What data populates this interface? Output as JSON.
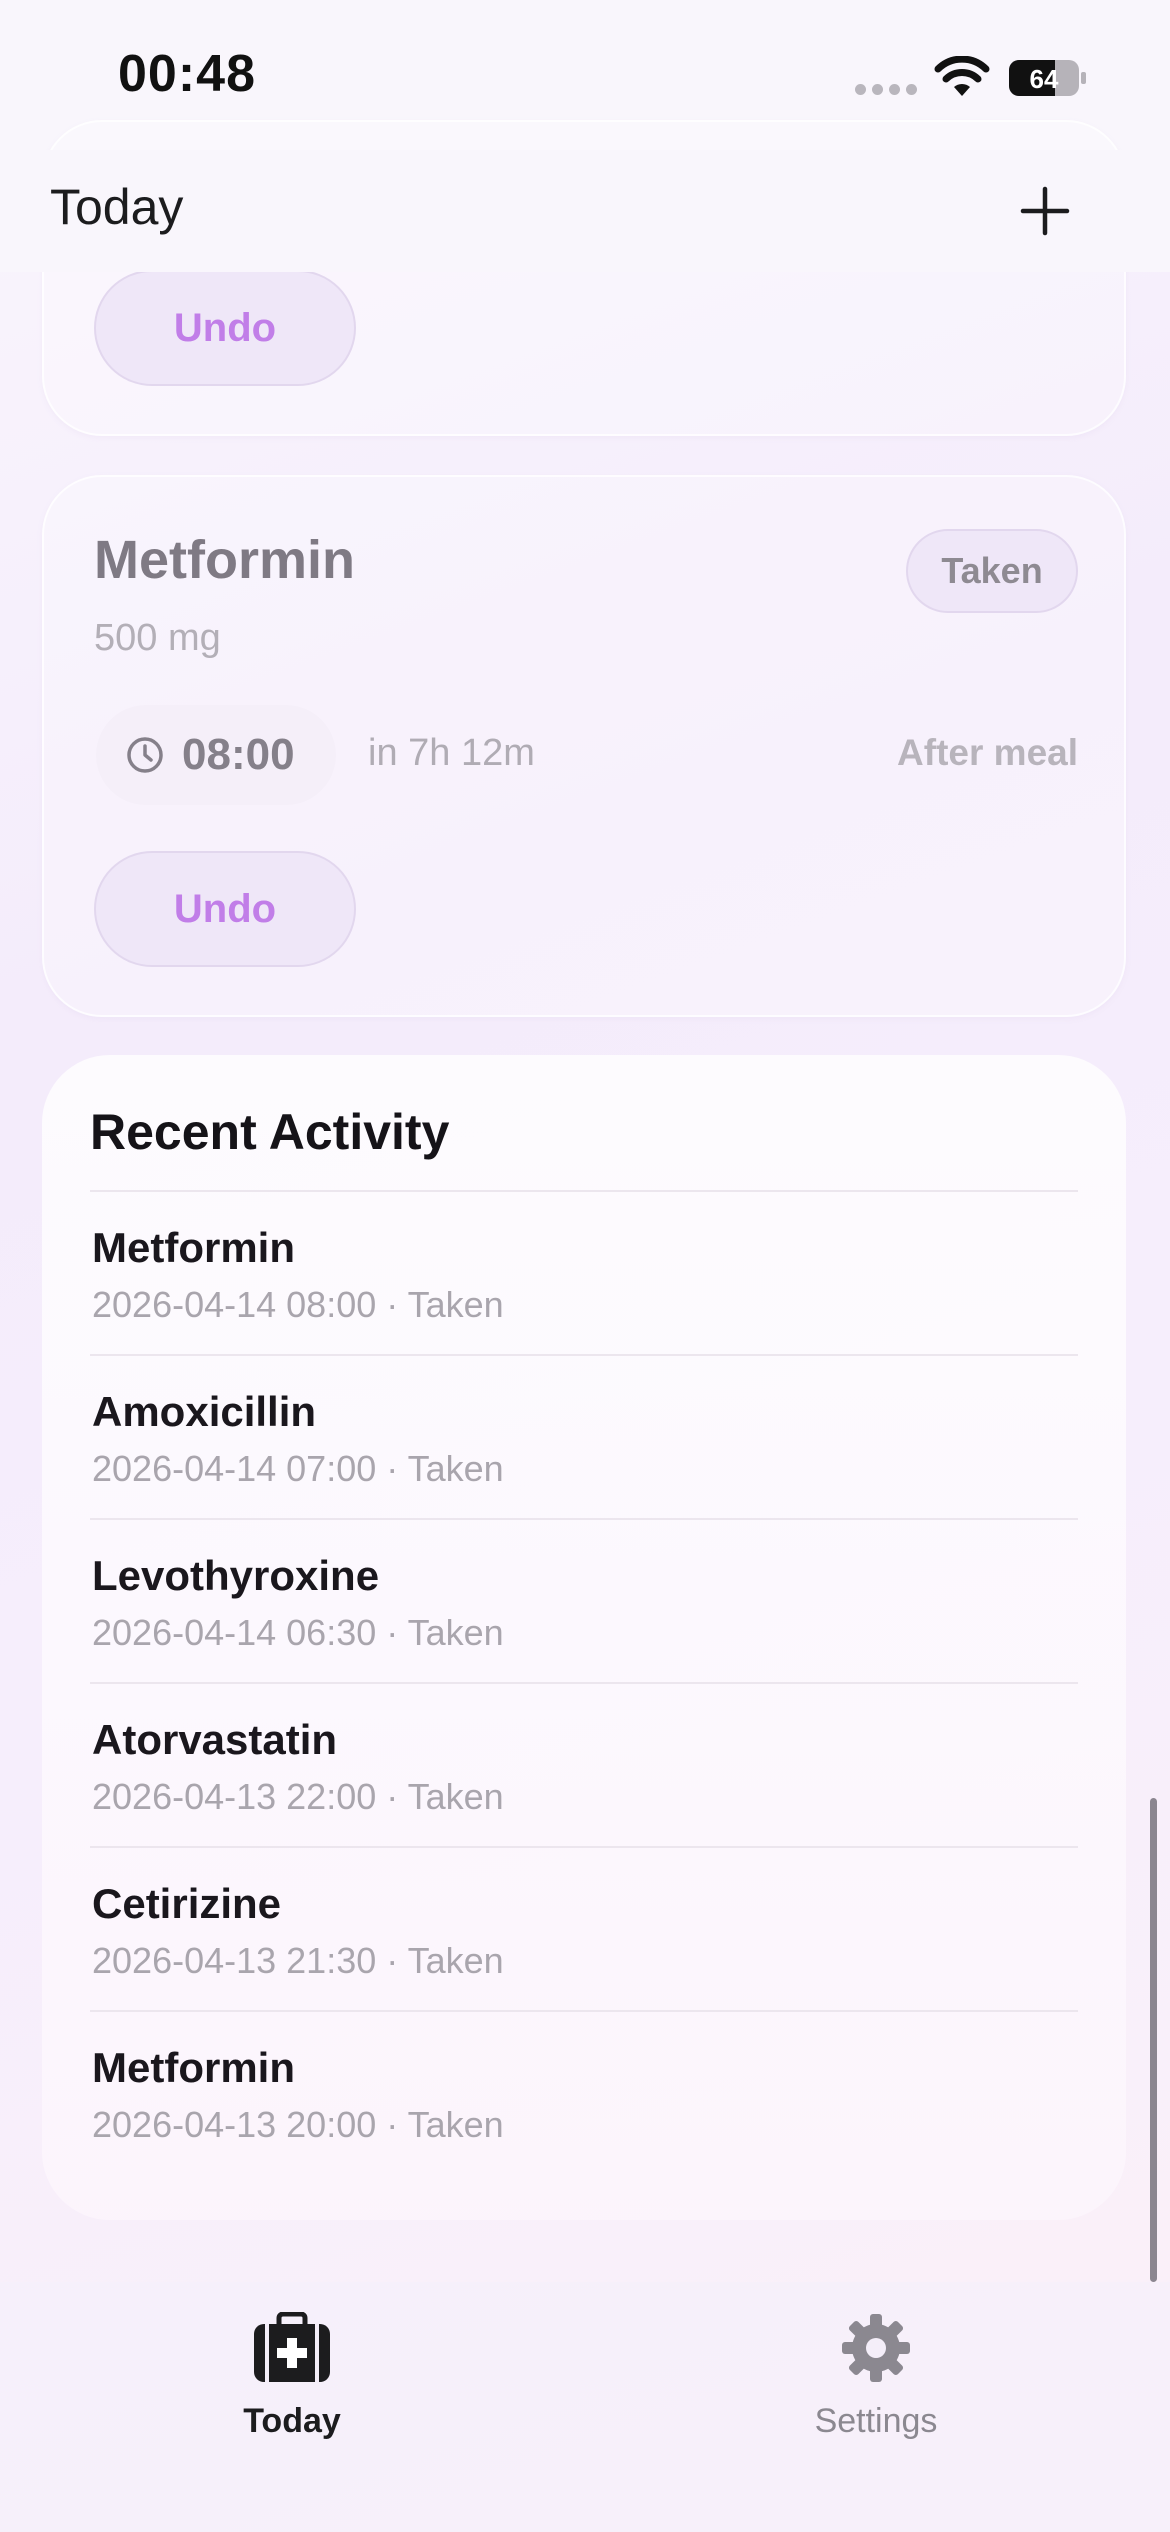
{
  "status_bar": {
    "time": "00:48",
    "battery": "64"
  },
  "header": {
    "title": "Today"
  },
  "top_card": {
    "undo_label": "Undo"
  },
  "medication_card": {
    "name": "Metformin",
    "dose": "500 mg",
    "status": "Taken",
    "time": "08:00",
    "relative": "in 7h 12m",
    "note": "After meal",
    "undo_label": "Undo"
  },
  "recent_activity": {
    "title": "Recent Activity",
    "items": [
      {
        "name": "Metformin",
        "meta": "2026-04-14 08:00 · Taken"
      },
      {
        "name": "Amoxicillin",
        "meta": "2026-04-14 07:00 · Taken"
      },
      {
        "name": "Levothyroxine",
        "meta": "2026-04-14 06:30 · Taken"
      },
      {
        "name": "Atorvastatin",
        "meta": "2026-04-13 22:00 · Taken"
      },
      {
        "name": "Cetirizine",
        "meta": "2026-04-13 21:30 · Taken"
      },
      {
        "name": "Metformin",
        "meta": "2026-04-13 20:00 · Taken"
      }
    ]
  },
  "tabs": [
    {
      "label": "Today",
      "icon": "medical-kit-icon",
      "active": true
    },
    {
      "label": "Settings",
      "icon": "gear-icon",
      "active": false
    }
  ],
  "colors": {
    "accent": "#c17ee8",
    "pill_bg": "#efe7f8",
    "text_primary": "#1a171d",
    "text_secondary": "#a9a5ad"
  }
}
